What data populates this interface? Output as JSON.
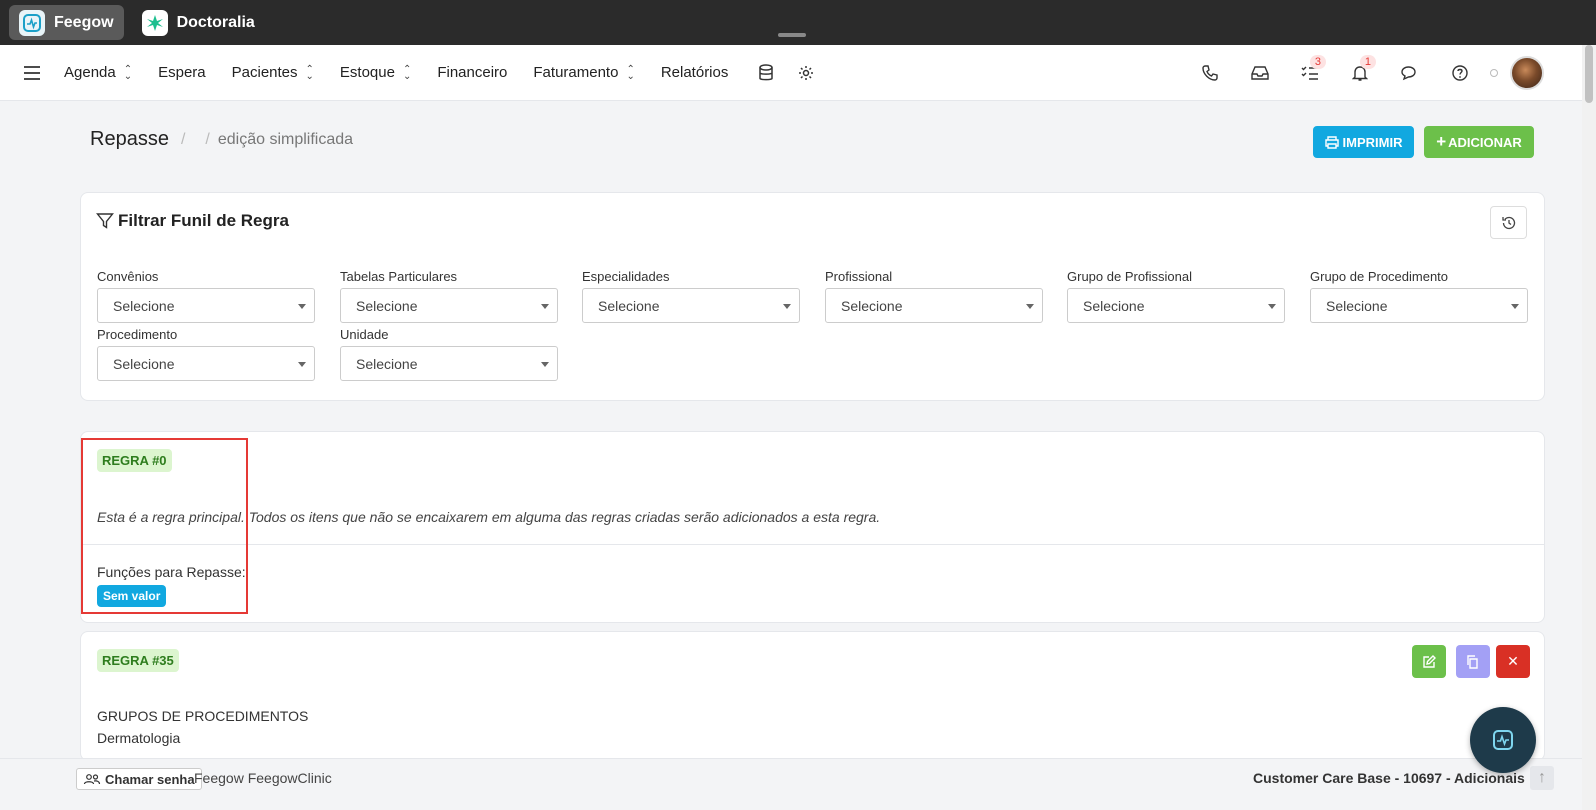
{
  "top_tabs": [
    {
      "label": "Feegow",
      "icon": "feegow-logo-icon",
      "active": true
    },
    {
      "label": "Doctoralia",
      "icon": "doctoralia-logo-icon",
      "active": false
    }
  ],
  "nav": {
    "items": [
      {
        "label": "Agenda",
        "dropdown": true
      },
      {
        "label": "Espera",
        "dropdown": false
      },
      {
        "label": "Pacientes",
        "dropdown": true
      },
      {
        "label": "Estoque",
        "dropdown": true
      },
      {
        "label": "Financeiro",
        "dropdown": false
      },
      {
        "label": "Faturamento",
        "dropdown": true
      },
      {
        "label": "Relatórios",
        "dropdown": false
      }
    ],
    "tasks_badge": "3",
    "notifications_badge": "1"
  },
  "page": {
    "title": "Repasse",
    "crumb_sep1": "/",
    "crumb_sep2": "/",
    "crumb": "edição simplificada",
    "print_label": "IMPRIMIR",
    "add_label": "ADICIONAR"
  },
  "filter": {
    "title": "Filtrar Funil de Regra",
    "fields": [
      {
        "label": "Convênios",
        "value": "Selecione"
      },
      {
        "label": "Tabelas Particulares",
        "value": "Selecione"
      },
      {
        "label": "Especialidades",
        "value": "Selecione"
      },
      {
        "label": "Profissional",
        "value": "Selecione"
      },
      {
        "label": "Grupo de Profissional",
        "value": "Selecione"
      },
      {
        "label": "Grupo de Procedimento",
        "value": "Selecione"
      },
      {
        "label": "Procedimento",
        "value": "Selecione"
      },
      {
        "label": "Unidade",
        "value": "Selecione"
      }
    ]
  },
  "rule0": {
    "badge": "REGRA #0",
    "description": "Esta é a regra principal. Todos os itens que não se encaixarem em alguma das regras criadas serão adicionados a esta regra.",
    "functions_label": "Funções para Repasse:",
    "functions_value": "Sem valor"
  },
  "rule35": {
    "badge": "REGRA #35",
    "group_title": "GRUPOS DE PROCEDIMENTOS",
    "group_value": "Dermatologia"
  },
  "footer": {
    "call_label": "Chamar senha",
    "brand": "Feegow FeegowClinic",
    "account": "Customer Care Base - 10697 - Adicionais"
  },
  "colors": {
    "accent_blue": "#11a8e0",
    "accent_green": "#6cc04a",
    "danger": "#e53935",
    "purple": "#a3a0f5"
  }
}
